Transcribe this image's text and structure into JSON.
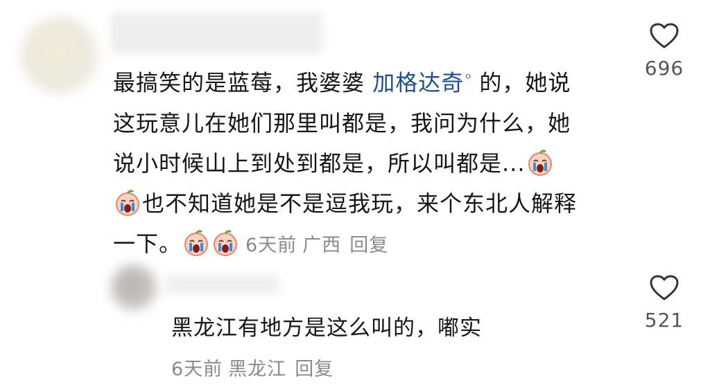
{
  "comment": {
    "text_before_mention": "最搞笑的是蓝莓，我婆婆 ",
    "mention": "加格达奇",
    "text_after_mention_line1": " 的，她说",
    "line2": "这玩意儿在她们那里叫都是，我问为什么，她",
    "line3": "说小时候山上到处到都是，所以叫都是...",
    "line4": "也不知道她是不是逗我玩，来个东北人解释",
    "line5": "一下。",
    "time": "6天前",
    "location": "广西",
    "reply_label": "回复",
    "likes": "696"
  },
  "reply": {
    "text": "黑龙江有地方是这么叫的，嘟实",
    "time": "6天前",
    "location": "黑龙江",
    "reply_label": "回复",
    "likes": "521"
  },
  "icons": {
    "like": "heart-outline-icon",
    "emoji": "crying-face-emoji"
  },
  "colors": {
    "mention": "#1f4e8c",
    "meta": "#8a8a8a",
    "text": "#161616"
  }
}
